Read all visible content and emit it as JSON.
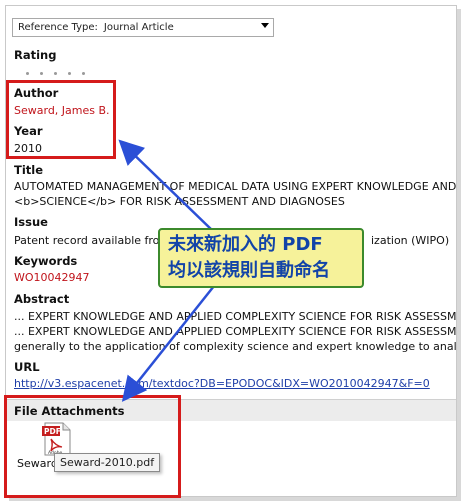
{
  "reference_type": {
    "label": "Reference Type:",
    "value": "Journal Article"
  },
  "rating": {
    "label": "Rating",
    "stars": 5
  },
  "author": {
    "label": "Author",
    "value": "Seward, James B."
  },
  "year": {
    "label": "Year",
    "value": "2010"
  },
  "title": {
    "label": "Title",
    "line1": "AUTOMATED MANAGEMENT OF MEDICAL DATA USING EXPERT KNOWLEDGE AND",
    "line2": "<b>SCIENCE</b> FOR RISK ASSESSMENT AND DIAGNOSES"
  },
  "issue": {
    "label": "Issue",
    "value_start": "Patent record available from",
    "value_end": "ization (WIPO)"
  },
  "keywords": {
    "label": "Keywords",
    "value": "WO10042947"
  },
  "abstract": {
    "label": "Abstract",
    "line1": "... EXPERT KNOWLEDGE AND APPLIED COMPLEXITY SCIENCE FOR RISK ASSESSMENT",
    "line2": "... EXPERT KNOWLEDGE AND APPLIED COMPLEXITY SCIENCE FOR RISK ASSESSMENT",
    "line3": "generally to the application of complexity science and expert knowledge to analyses"
  },
  "url": {
    "label": "URL",
    "value": "http://v3.espacenet.com/textdoc?DB=EPODOC&IDX=WO2010042947&F=0"
  },
  "file_attachments": {
    "label": "File Attachments",
    "icon_caption": "PDF",
    "icon_brand": "Adobe",
    "file_caption": "Seward-2",
    "tooltip": "Seward-2010.pdf"
  },
  "annotation": {
    "line1": "未來新加入的 PDF",
    "line2": "均以該規則自動命名"
  },
  "colors": {
    "highlight_border": "#d51b1b",
    "arrow": "#2b4fd6",
    "callout_bg": "#f6f29a",
    "callout_text": "#1244a8",
    "author_red": "#c0141b",
    "link_blue": "#1f3fa8"
  }
}
